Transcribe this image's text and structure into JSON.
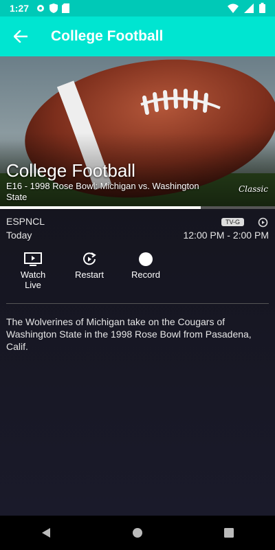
{
  "status_bar": {
    "time": "1:27",
    "icons": [
      "settings-icon",
      "shield-icon",
      "sd-card-icon"
    ],
    "right_icons": [
      "wifi-icon",
      "cellular-icon",
      "battery-icon"
    ]
  },
  "app_bar": {
    "back_icon": "arrow-back-icon",
    "title": "College Football"
  },
  "hero": {
    "title": "College Football",
    "episode": "E16 - 1998 Rose Bowl: Michigan vs. Washington State",
    "network_logo": "Classic",
    "progress_fraction": 0.73
  },
  "details": {
    "network": "ESPNCL",
    "day": "Today",
    "rating": "TV-G",
    "time_range": "12:00 PM - 2:00 PM",
    "description": "The Wolverines of Michigan take on the Cougars of Washington State in the 1998 Rose Bowl from Pasadena, Calif."
  },
  "actions": [
    {
      "label": "Watch\nLive",
      "icon": "tv-icon"
    },
    {
      "label": "Restart",
      "icon": "restart-icon"
    },
    {
      "label": "Record",
      "icon": "record-icon"
    }
  ],
  "nav_bar": [
    "back-triangle-icon",
    "home-circle-icon",
    "recents-square-icon"
  ],
  "colors": {
    "status_bar": "#00c9b7",
    "app_bar": "#00e5d1",
    "background": "#15151f"
  }
}
